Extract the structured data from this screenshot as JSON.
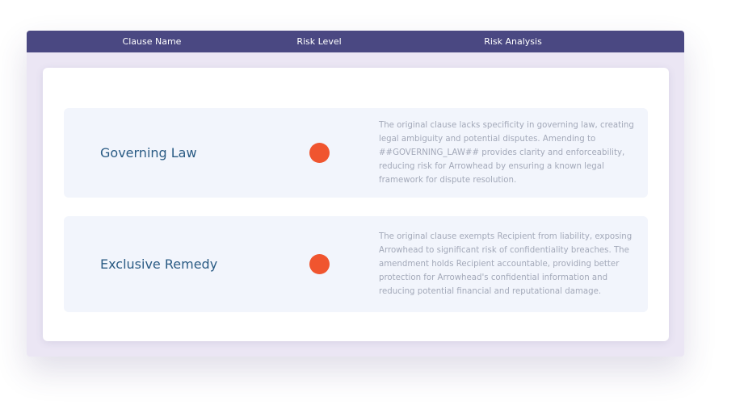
{
  "table": {
    "columns": {
      "clause_name": "Clause Name",
      "risk_level": "Risk Level",
      "risk_analysis": "Risk Analysis"
    },
    "rows": [
      {
        "clause_name": "Governing Law",
        "risk_color": "#f0552f",
        "analysis": "The original clause lacks specificity in governing law, creating legal ambiguity and potential disputes. Amending to ##GOVERNING_LAW## provides clarity and enforceability, reducing risk for Arrowhead by ensuring a known legal framework for dispute resolution."
      },
      {
        "clause_name": "Exclusive Remedy",
        "risk_color": "#f0552f",
        "analysis": "The original clause exempts Recipient from liability, exposing Arrowhead to significant risk of confidentiality breaches. The amendment holds Recipient accountable, providing better protection for Arrowhead's confidential information and reducing potential financial and reputational damage."
      }
    ]
  },
  "colors": {
    "header_bg": "#4a4882",
    "frame_bg": "#ebe6f4",
    "row_bg": "#f2f5fc",
    "clause_text": "#2a5b84",
    "analysis_text": "#a3a9b9",
    "risk_high": "#f0552f"
  }
}
